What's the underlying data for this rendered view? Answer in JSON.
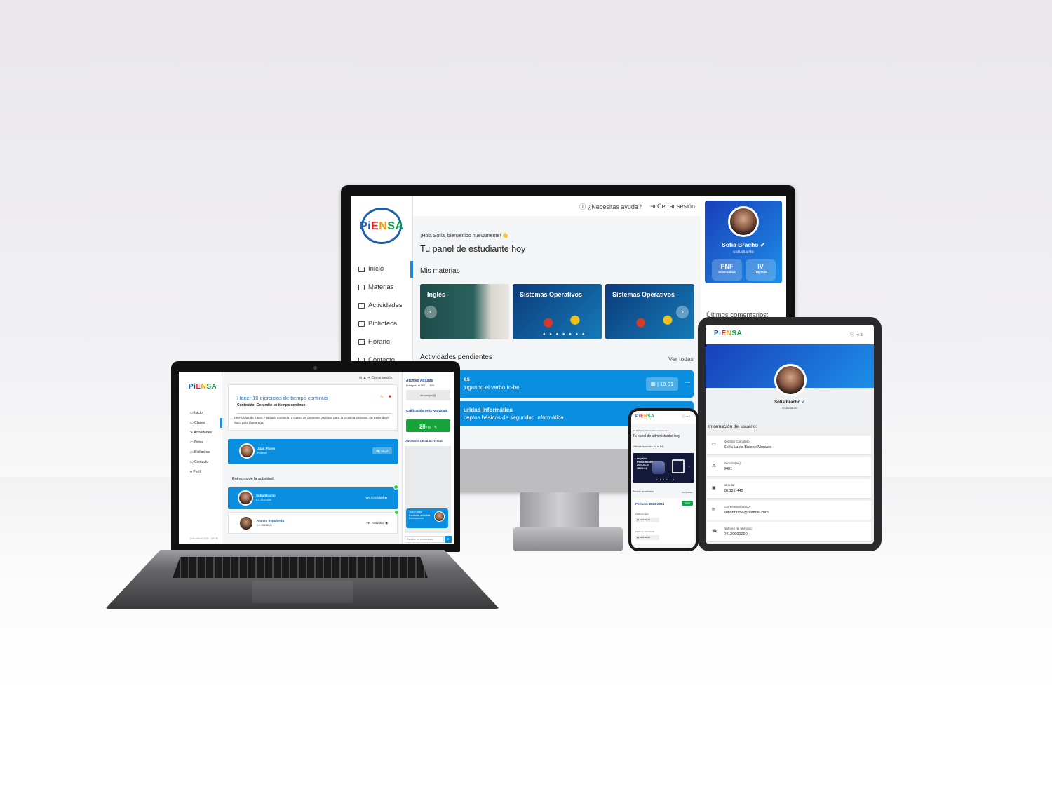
{
  "desktop": {
    "logo": {
      "pi": "Pi",
      "e": "E",
      "n": "N",
      "s": "SA"
    },
    "nav": [
      "Inicio",
      "Materias",
      "Actividades",
      "Biblioteca",
      "Horario",
      "Contacto"
    ],
    "topbar": {
      "help": "¿Necesitas ayuda?",
      "logout": "Cerrar sesión"
    },
    "greeting": "¡Hola Sofía, bienvenido nuevamente!",
    "title": "Tu panel de estudiante hoy",
    "subjects_heading": "Mis materias",
    "subjects": [
      "Inglés",
      "Sistemas Operativos",
      "Sistemas Operativos"
    ],
    "os_logos": "iOS",
    "pending_heading": "Actividades pendientes",
    "see_all": "Ver todas",
    "activities": [
      {
        "title": "es",
        "desc": "jugando el verbo to-be",
        "date": "| 19-01"
      },
      {
        "title": "uridad Informática",
        "desc": "ceptos básicos de seguridad informática"
      }
    ],
    "profile": {
      "name": "Sofía Bracho",
      "role": "estudiante",
      "pnf": "PNF",
      "pnf_sub": "Informática",
      "trayecto": "IV",
      "trayecto_sub": "Trayecto"
    },
    "comments_heading": "Últimos comentarios:"
  },
  "laptop": {
    "logo": {
      "pi": "Pi",
      "e": "E",
      "n": "N",
      "s": "SA"
    },
    "nav": [
      "Inicio",
      "Clases",
      "Actividades",
      "Notas",
      "Biblioteca",
      "Contacto",
      "Perfil"
    ],
    "footer": "Aula Virtual 2023 - UPTM",
    "topbar_logout": "Cerrar sesión",
    "activity_title": "Hacer 10 ejercicios de tiempo continuo",
    "content_label": "Contenido: Gerundio en tiempo continuo",
    "description": "3 ejercicios de futuro y pasado continuo, y cuatro de presente continuo para la proxima semana. Se extiende el plazo para la entrega.",
    "teacher": {
      "name": "Juan Flores",
      "role": "Profesor",
      "date": "28-12"
    },
    "deliveries_heading": "Entregas de la actividad:",
    "deliveries": [
      {
        "name": "Sofía Bracho",
        "ci": "C.I. 28122440",
        "action": "Ver Actividad"
      },
      {
        "name": "Alonso Sepulveda",
        "ci": "C.I. 29634521",
        "action": "Ver Actividad"
      }
    ],
    "attachment_heading": "Archivo Adjunto",
    "attachment_date": "Entregado el 18/11, 12:09",
    "download": "descargar",
    "grade_heading": "Calificación de la Actividad",
    "grade": "20",
    "grade_unit": "PTS",
    "discussion": "DISCUSIÓN DE LA ACTIVIDAD",
    "chat_msg": "Juan Flores: Excelente actividad, felicitaciones!",
    "comment_placeholder": "Escribe un comentario"
  },
  "phone": {
    "logo": {
      "pi": "Pi",
      "e": "E",
      "n": "N",
      "s": "SA"
    },
    "greeting": "¡Hola Pepito, bienvenido nuevamente!",
    "title": "Tu panel de administrador hoy",
    "last_actions": "Últimas acciones en la BD",
    "backup": {
      "label": "respaldo",
      "user": "Pepito Montero",
      "date": "2024-01-04",
      "time": "18:05:34"
    },
    "period_heading": "Período académico",
    "see_details": "Ver detalles",
    "period": "Periodo: 2023-2024",
    "status": "Activo",
    "start_label": "Fecha de inicio",
    "start": "2023-01-30",
    "end_label": "Fecha de culminación",
    "end": "2024-11-20"
  },
  "tablet": {
    "logo": {
      "pi": "Pi",
      "e": "E",
      "n": "N",
      "s": "SA"
    },
    "name": "Sofía Bracho",
    "role": "Estudiante",
    "info_heading": "Información del usuario:",
    "fields": [
      {
        "label": "Nombre Completo:",
        "value": "Sofía Lucía Bracho Morales"
      },
      {
        "label": "Sección(es):",
        "value": "3401"
      },
      {
        "label": "Cédula:",
        "value": "28.122.440"
      },
      {
        "label": "Correo electrónico:",
        "value": "sofiabracho@hotmail.com"
      },
      {
        "label": "Número de teléfono:",
        "value": "04120000000"
      }
    ]
  }
}
